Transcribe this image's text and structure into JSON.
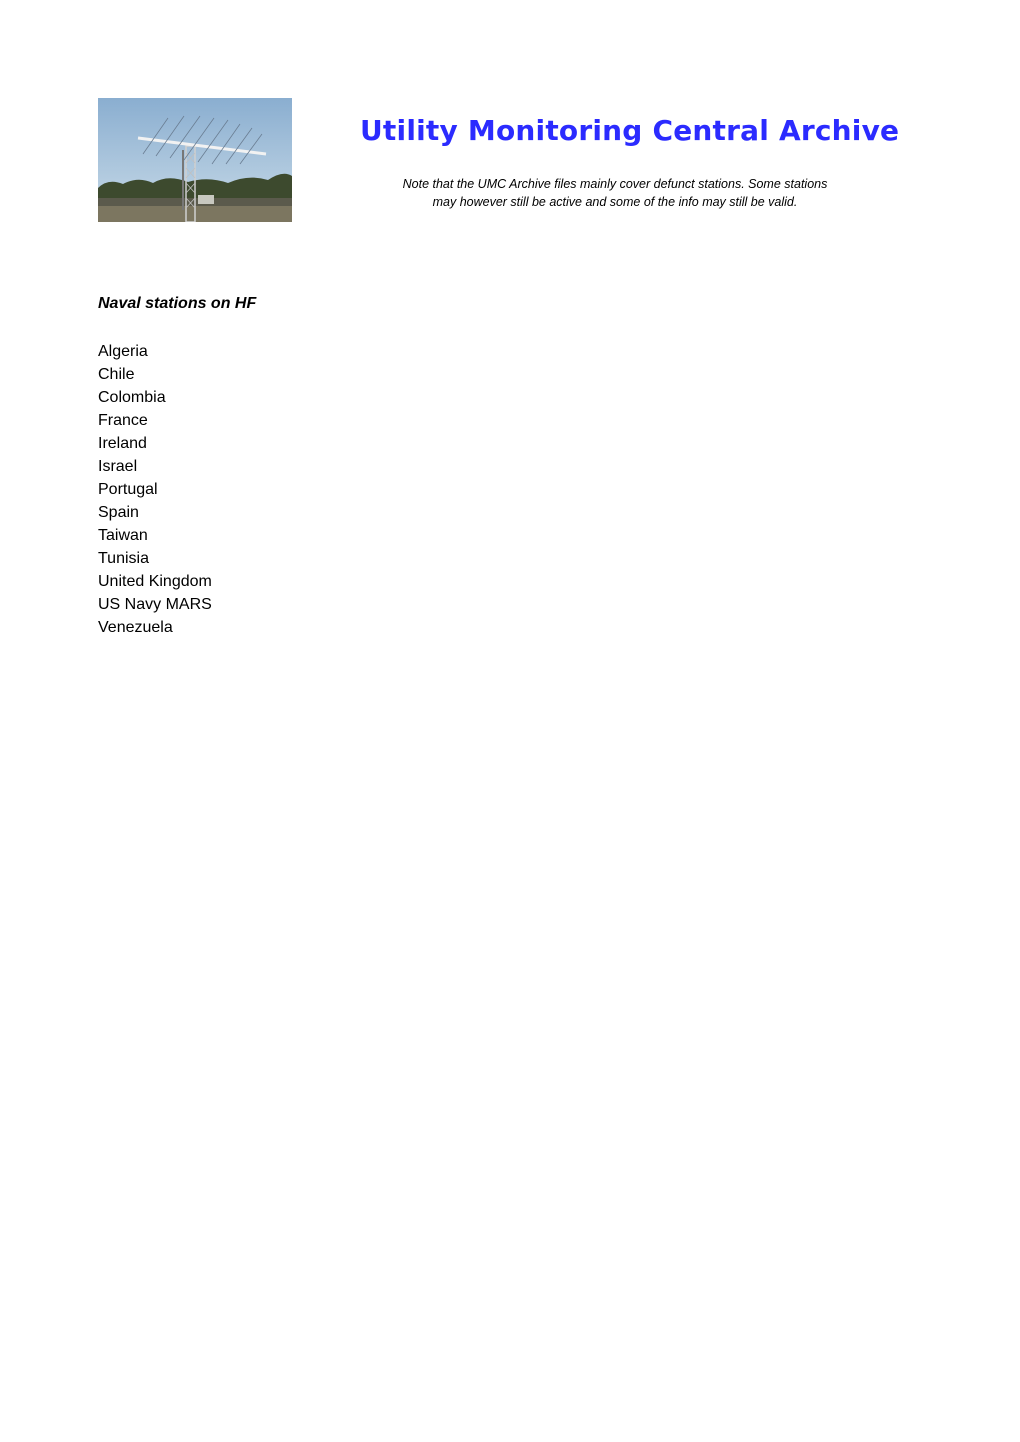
{
  "header": {
    "image": "antenna-tower-photo",
    "title": "Utility Monitoring Central Archive",
    "note_line1": "Note that the UMC Archive files mainly cover defunct stations. Some stations",
    "note_line2": "may however still be active and some of the info may still be valid.",
    "title_color": "#2b2bff"
  },
  "section": {
    "heading": "Naval stations on HF",
    "countries": [
      "Algeria",
      "Chile",
      "Colombia",
      "France",
      "Ireland",
      "Israel",
      "Portugal",
      "Spain",
      "Taiwan",
      "Tunisia",
      "United Kingdom",
      "US Navy MARS",
      "Venezuela"
    ]
  }
}
